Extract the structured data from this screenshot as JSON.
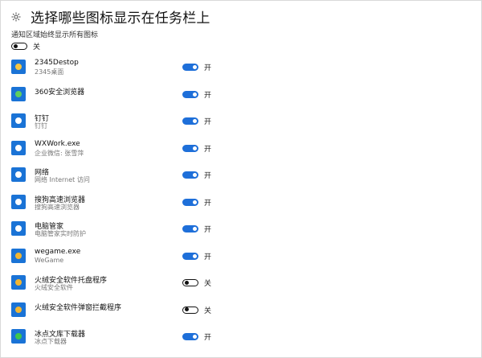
{
  "header": {
    "title": "选择哪些图标显示在任务栏上"
  },
  "master_toggle": {
    "label": "通知区域始终显示所有图标",
    "state": "off",
    "state_label": "关"
  },
  "colors": {
    "accent": "#1e6fd9",
    "icon_bg": "#1a73d6"
  },
  "apps": [
    {
      "name": "2345Destop",
      "desc": "2345桌面",
      "state": "on",
      "state_label": "开",
      "icon": "desktop-app-icon",
      "icon_color": "#1a73d6",
      "dot_color": "#f5c542"
    },
    {
      "name": "360安全浏览器",
      "desc": "",
      "state": "on",
      "state_label": "开",
      "icon": "browser-360-icon",
      "icon_color": "#1a73d6",
      "dot_color": "#5fcf5f"
    },
    {
      "name": "钉钉",
      "desc": "钉钉",
      "state": "on",
      "state_label": "开",
      "icon": "dingtalk-icon",
      "icon_color": "#1a73d6",
      "dot_color": "#ffffff"
    },
    {
      "name": "WXWork.exe",
      "desc": "企业微信: 张雪萍",
      "state": "on",
      "state_label": "开",
      "icon": "wxwork-icon",
      "icon_color": "#1a73d6",
      "dot_color": "#ffffff"
    },
    {
      "name": "网络",
      "desc": "网络 Internet 访问",
      "state": "on",
      "state_label": "开",
      "icon": "network-icon",
      "icon_color": "#1a73d6",
      "dot_color": "#ffffff"
    },
    {
      "name": "搜狗高速浏览器",
      "desc": "搜狗高速浏览器",
      "state": "on",
      "state_label": "开",
      "icon": "sogou-browser-icon",
      "icon_color": "#1a73d6",
      "dot_color": "#ffffff"
    },
    {
      "name": "电脑管家",
      "desc": "电脑管家实时防护",
      "state": "on",
      "state_label": "开",
      "icon": "pc-manager-icon",
      "icon_color": "#1a73d6",
      "dot_color": "#ffffff"
    },
    {
      "name": "wegame.exe",
      "desc": "WeGame",
      "state": "on",
      "state_label": "开",
      "icon": "wegame-icon",
      "icon_color": "#1a73d6",
      "dot_color": "#f2b632"
    },
    {
      "name": "火绒安全软件托盘程序",
      "desc": "火绒安全软件",
      "state": "off",
      "state_label": "关",
      "icon": "huorong-tray-icon",
      "icon_color": "#1a73d6",
      "dot_color": "#f2b632"
    },
    {
      "name": "火绒安全软件弹窗拦截程序",
      "desc": "",
      "state": "off",
      "state_label": "关",
      "icon": "huorong-popup-icon",
      "icon_color": "#1a73d6",
      "dot_color": "#f2b632"
    },
    {
      "name": "冰点文库下载器",
      "desc": "冰点下载器",
      "state": "on",
      "state_label": "开",
      "icon": "bingdian-downloader-icon",
      "icon_color": "#1a73d6",
      "dot_color": "#3ec64b"
    }
  ]
}
